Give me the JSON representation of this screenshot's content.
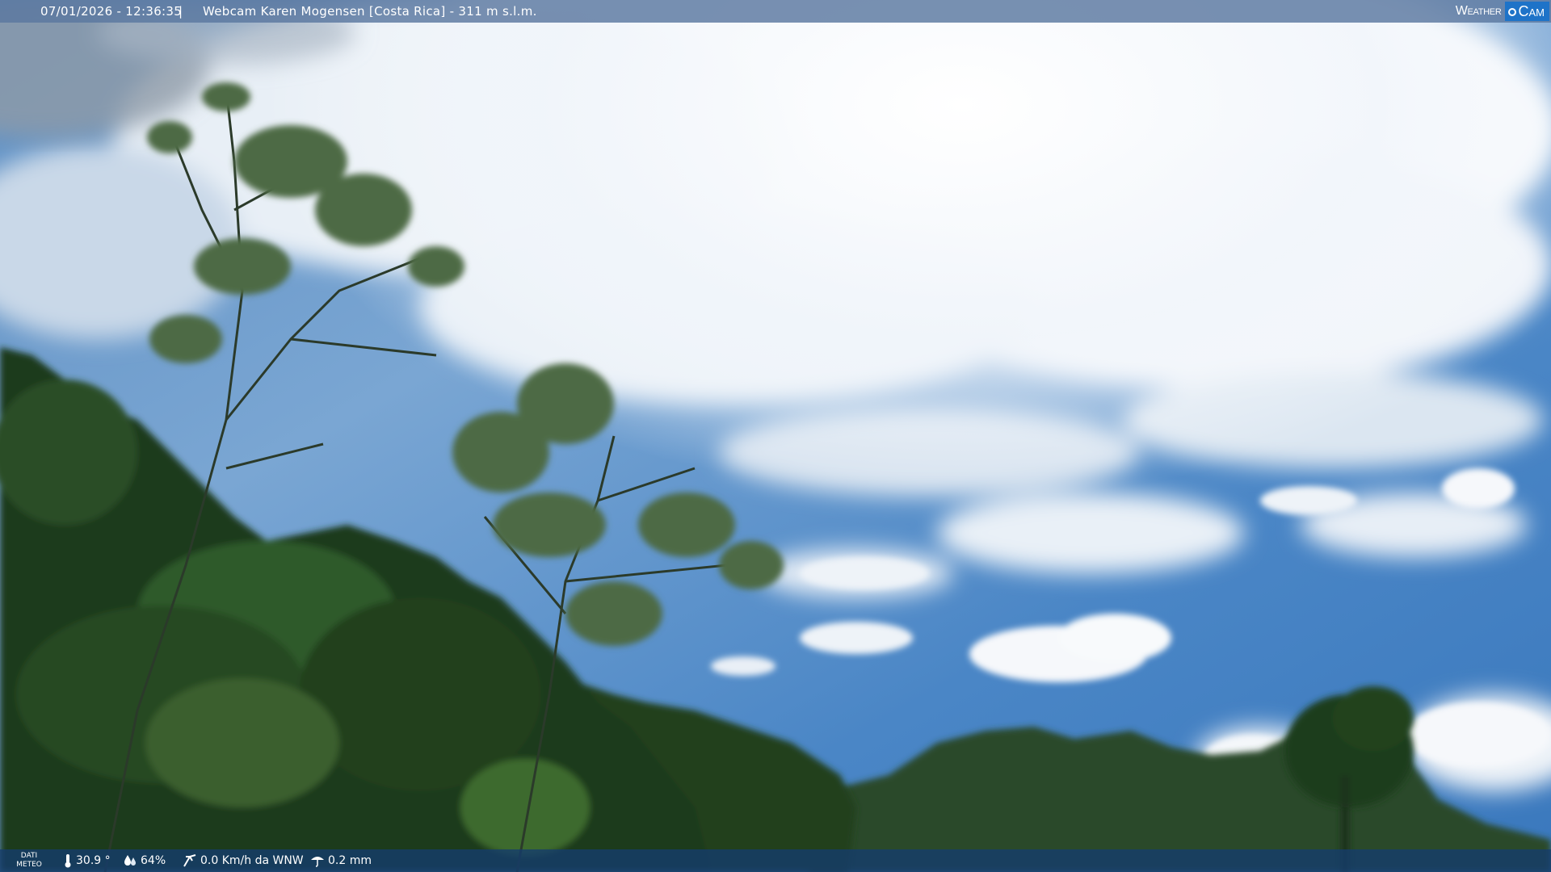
{
  "header": {
    "datetime": "07/01/2026 - 12:36:35",
    "separator": "|",
    "title": "Webcam Karen Mogensen [Costa Rica]  - 311 m s.l.m."
  },
  "logo": {
    "word1": "Weather",
    "word2": "Cam"
  },
  "footer": {
    "label_line1": "DATI",
    "label_line2": "METEO",
    "temperature": "30.9 °",
    "humidity": "64%",
    "wind": "0.0 Km/h da WNW",
    "rain": "0.2 mm",
    "icons": [
      "thermometer-icon",
      "humidity-drop-icon",
      "wind-icon",
      "rain-icon"
    ]
  },
  "colors": {
    "sky_top": "#dfe9f3",
    "sky_blue": "#3f7fc0",
    "foliage": "#1f3a1c",
    "bar": "#143c6e"
  }
}
